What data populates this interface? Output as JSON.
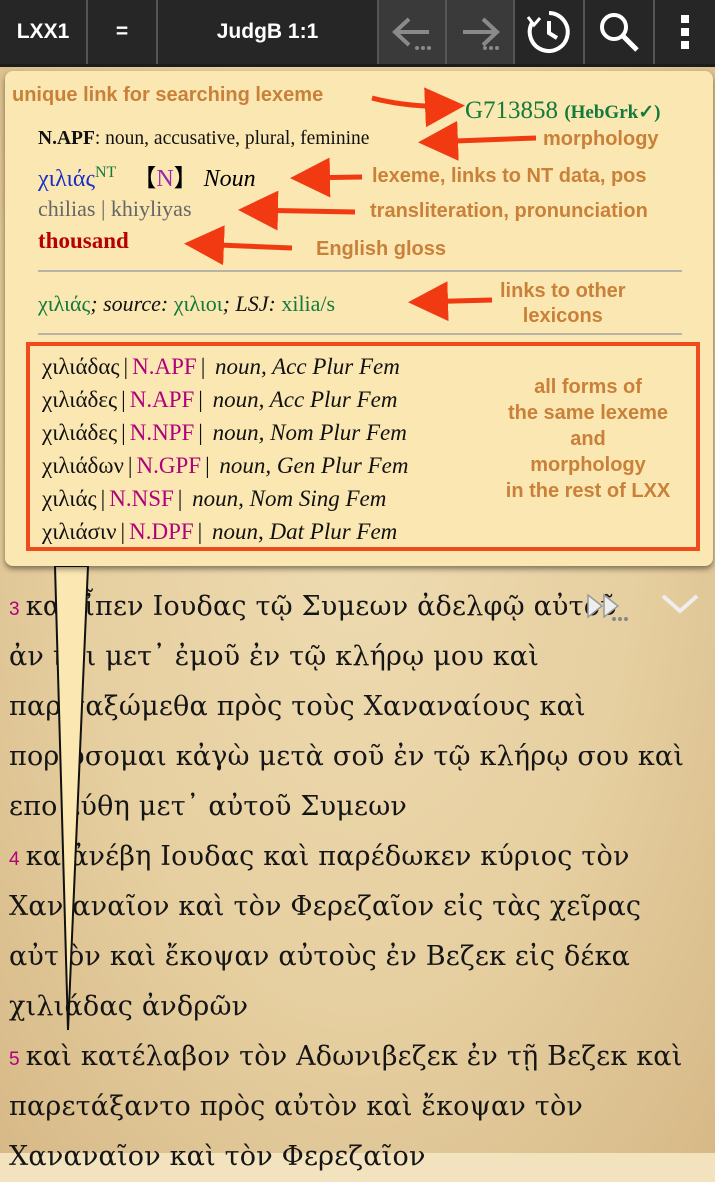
{
  "toolbar": {
    "module": "LXX1",
    "menu": "=",
    "reference": "JudgB 1:1"
  },
  "popup": {
    "strongs": "G713858",
    "strongs_tag": "(HebGrk",
    "strongs_check": "✓)",
    "morph_code": "N.APF",
    "morph_text": ": noun, accusative, plural, feminine",
    "lexeme": "χιλιάς",
    "lexeme_sup": "NT",
    "pos_open": "【",
    "pos_code": "N",
    "pos_close": "】",
    "pos_word": "Noun",
    "translit": "chilias",
    "pronunciation": "khiyliyas",
    "gloss": "thousand",
    "link_lexeme": "χιλιάς",
    "link_source_label": "; source:",
    "link_source": "χιλιοι",
    "link_lsj_label": "; LSJ:",
    "link_lsj": "xilia/s",
    "forms": [
      {
        "word": "χιλιάδας",
        "code": "N.APF",
        "desc": "noun, Acc Plur Fem"
      },
      {
        "word": "χιλιάδες",
        "code": "N.APF",
        "desc": "noun, Acc Plur Fem"
      },
      {
        "word": "χιλιάδες",
        "code": "N.NPF",
        "desc": "noun, Nom Plur Fem"
      },
      {
        "word": "χιλιάδων",
        "code": "N.GPF",
        "desc": "noun, Gen Plur Fem"
      },
      {
        "word": "χιλιάς",
        "code": "N.NSF",
        "desc": "noun, Nom Sing Fem"
      },
      {
        "word": "χιλιάσιν",
        "code": "N.DPF",
        "desc": "noun, Dat Plur Fem"
      }
    ]
  },
  "annotations": {
    "unique_link": "unique link for searching lexeme",
    "morphology": "morphology",
    "lexeme": "lexeme, links to NT data, pos",
    "translit": "transliteration, pronunciation",
    "gloss": "English gloss",
    "other_lexicons_1": "links to other",
    "other_lexicons_2": "lexicons",
    "forms_1": "all forms of",
    "forms_2": "the same lexeme",
    "forms_3": "and",
    "forms_4": "morphology",
    "forms_5": "in the rest of LXX"
  },
  "text": {
    "v3_num": "3",
    "v3_l1": "κα  εἶπεν Ιουδας τῷ Συμεων ἀδελφῷ αὐτοῦ",
    "v3_l2": "ἀν  ηθι μετ᾽ ἐμοῦ ἐν τῷ κλήρῳ μου καὶ",
    "v3_l3": "παρ  ταξώμεθα πρὸς τοὺς Χαναναίους καὶ",
    "v3_l4": "πορ  ύσομαι κἀγὼ μετὰ σοῦ ἐν τῷ κλήρῳ σου καὶ",
    "v3_l5": "επο  εύθη μετ᾽ αὐτοῦ Συμεων",
    "v4_num": "4",
    "v4_l1": "κα  ἀνέβη Ιουδας καὶ παρέδωκεν κύριος τὸν",
    "v4_l2": "Χαν  αναῖον καὶ τὸν Φερεζαῖον εἰς τὰς χεῖρας",
    "v4_l3": "αὐτ  ὸν καὶ ἔκοψαν αὐτοὺς ἐν Βεζεκ εἰς δέκα",
    "v4_l4": "χιλιάδας ἀνδρῶν",
    "v5_num": "5",
    "v5_l1": "καὶ κατέλαβον τὸν Αδωνιβεζεκ ἐν τῇ Βεζεκ καὶ",
    "v5_l2": "παρετάξαντο πρὸς αὐτὸν καὶ ἔκοψαν τὸν",
    "v5_l3": "Χαναναῖον καὶ τὸν Φερεζαῖον"
  }
}
